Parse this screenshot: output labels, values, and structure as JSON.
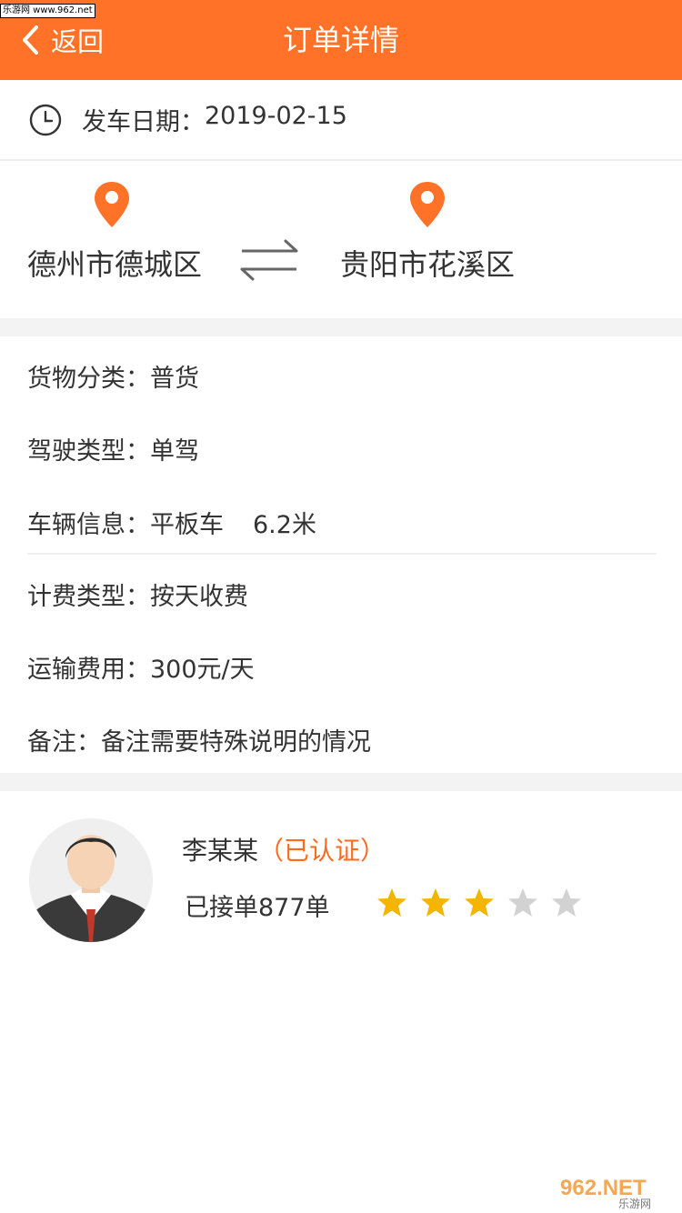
{
  "watermark": {
    "top": "乐游网 www.962.net",
    "bottom_big": "962.NET",
    "bottom_small": "乐游网"
  },
  "header": {
    "back_label": "返回",
    "title": "订单详情",
    "bg_color": "#ff7228"
  },
  "departure": {
    "label": "发车日期：",
    "value": "2019-02-15"
  },
  "route": {
    "from": "德州市德城区",
    "to": "贵阳市花溪区",
    "pin_color": "#ff7228"
  },
  "details": {
    "cargo": {
      "label": "货物分类：",
      "value": "普货"
    },
    "driving": {
      "label": "驾驶类型：",
      "value": "单驾"
    },
    "vehicle": {
      "label": "车辆信息：",
      "value": "平板车",
      "length": "6.2米"
    },
    "billing": {
      "label": "计费类型：",
      "value": "按天收费"
    },
    "fee": {
      "label": "运输费用：",
      "value": "300元/天"
    },
    "note": {
      "label": "备注：",
      "value": "备注需要特殊说明的情况"
    }
  },
  "driver": {
    "name": "李某某",
    "status": "（已认证）",
    "orders": "已接单877单",
    "rating": 3,
    "rating_max": 5,
    "star_on_color": "#f5b400",
    "star_off_color": "#d2d2d2"
  }
}
